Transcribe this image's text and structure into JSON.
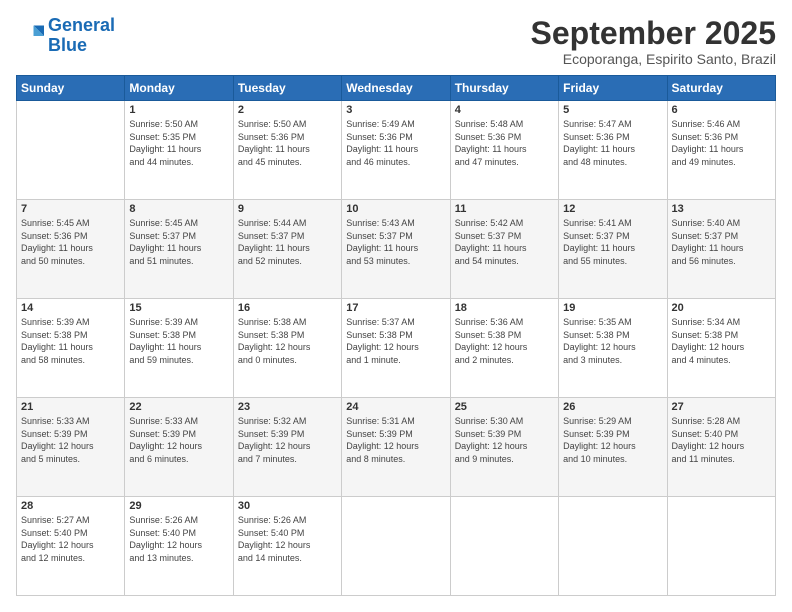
{
  "logo": {
    "line1": "General",
    "line2": "Blue"
  },
  "title": "September 2025",
  "location": "Ecoporanga, Espirito Santo, Brazil",
  "days_of_week": [
    "Sunday",
    "Monday",
    "Tuesday",
    "Wednesday",
    "Thursday",
    "Friday",
    "Saturday"
  ],
  "weeks": [
    [
      {
        "day": "",
        "info": ""
      },
      {
        "day": "1",
        "info": "Sunrise: 5:50 AM\nSunset: 5:35 PM\nDaylight: 11 hours\nand 44 minutes."
      },
      {
        "day": "2",
        "info": "Sunrise: 5:50 AM\nSunset: 5:36 PM\nDaylight: 11 hours\nand 45 minutes."
      },
      {
        "day": "3",
        "info": "Sunrise: 5:49 AM\nSunset: 5:36 PM\nDaylight: 11 hours\nand 46 minutes."
      },
      {
        "day": "4",
        "info": "Sunrise: 5:48 AM\nSunset: 5:36 PM\nDaylight: 11 hours\nand 47 minutes."
      },
      {
        "day": "5",
        "info": "Sunrise: 5:47 AM\nSunset: 5:36 PM\nDaylight: 11 hours\nand 48 minutes."
      },
      {
        "day": "6",
        "info": "Sunrise: 5:46 AM\nSunset: 5:36 PM\nDaylight: 11 hours\nand 49 minutes."
      }
    ],
    [
      {
        "day": "7",
        "info": "Sunrise: 5:45 AM\nSunset: 5:36 PM\nDaylight: 11 hours\nand 50 minutes."
      },
      {
        "day": "8",
        "info": "Sunrise: 5:45 AM\nSunset: 5:37 PM\nDaylight: 11 hours\nand 51 minutes."
      },
      {
        "day": "9",
        "info": "Sunrise: 5:44 AM\nSunset: 5:37 PM\nDaylight: 11 hours\nand 52 minutes."
      },
      {
        "day": "10",
        "info": "Sunrise: 5:43 AM\nSunset: 5:37 PM\nDaylight: 11 hours\nand 53 minutes."
      },
      {
        "day": "11",
        "info": "Sunrise: 5:42 AM\nSunset: 5:37 PM\nDaylight: 11 hours\nand 54 minutes."
      },
      {
        "day": "12",
        "info": "Sunrise: 5:41 AM\nSunset: 5:37 PM\nDaylight: 11 hours\nand 55 minutes."
      },
      {
        "day": "13",
        "info": "Sunrise: 5:40 AM\nSunset: 5:37 PM\nDaylight: 11 hours\nand 56 minutes."
      }
    ],
    [
      {
        "day": "14",
        "info": "Sunrise: 5:39 AM\nSunset: 5:38 PM\nDaylight: 11 hours\nand 58 minutes."
      },
      {
        "day": "15",
        "info": "Sunrise: 5:39 AM\nSunset: 5:38 PM\nDaylight: 11 hours\nand 59 minutes."
      },
      {
        "day": "16",
        "info": "Sunrise: 5:38 AM\nSunset: 5:38 PM\nDaylight: 12 hours\nand 0 minutes."
      },
      {
        "day": "17",
        "info": "Sunrise: 5:37 AM\nSunset: 5:38 PM\nDaylight: 12 hours\nand 1 minute."
      },
      {
        "day": "18",
        "info": "Sunrise: 5:36 AM\nSunset: 5:38 PM\nDaylight: 12 hours\nand 2 minutes."
      },
      {
        "day": "19",
        "info": "Sunrise: 5:35 AM\nSunset: 5:38 PM\nDaylight: 12 hours\nand 3 minutes."
      },
      {
        "day": "20",
        "info": "Sunrise: 5:34 AM\nSunset: 5:38 PM\nDaylight: 12 hours\nand 4 minutes."
      }
    ],
    [
      {
        "day": "21",
        "info": "Sunrise: 5:33 AM\nSunset: 5:39 PM\nDaylight: 12 hours\nand 5 minutes."
      },
      {
        "day": "22",
        "info": "Sunrise: 5:33 AM\nSunset: 5:39 PM\nDaylight: 12 hours\nand 6 minutes."
      },
      {
        "day": "23",
        "info": "Sunrise: 5:32 AM\nSunset: 5:39 PM\nDaylight: 12 hours\nand 7 minutes."
      },
      {
        "day": "24",
        "info": "Sunrise: 5:31 AM\nSunset: 5:39 PM\nDaylight: 12 hours\nand 8 minutes."
      },
      {
        "day": "25",
        "info": "Sunrise: 5:30 AM\nSunset: 5:39 PM\nDaylight: 12 hours\nand 9 minutes."
      },
      {
        "day": "26",
        "info": "Sunrise: 5:29 AM\nSunset: 5:39 PM\nDaylight: 12 hours\nand 10 minutes."
      },
      {
        "day": "27",
        "info": "Sunrise: 5:28 AM\nSunset: 5:40 PM\nDaylight: 12 hours\nand 11 minutes."
      }
    ],
    [
      {
        "day": "28",
        "info": "Sunrise: 5:27 AM\nSunset: 5:40 PM\nDaylight: 12 hours\nand 12 minutes."
      },
      {
        "day": "29",
        "info": "Sunrise: 5:26 AM\nSunset: 5:40 PM\nDaylight: 12 hours\nand 13 minutes."
      },
      {
        "day": "30",
        "info": "Sunrise: 5:26 AM\nSunset: 5:40 PM\nDaylight: 12 hours\nand 14 minutes."
      },
      {
        "day": "",
        "info": ""
      },
      {
        "day": "",
        "info": ""
      },
      {
        "day": "",
        "info": ""
      },
      {
        "day": "",
        "info": ""
      }
    ]
  ]
}
